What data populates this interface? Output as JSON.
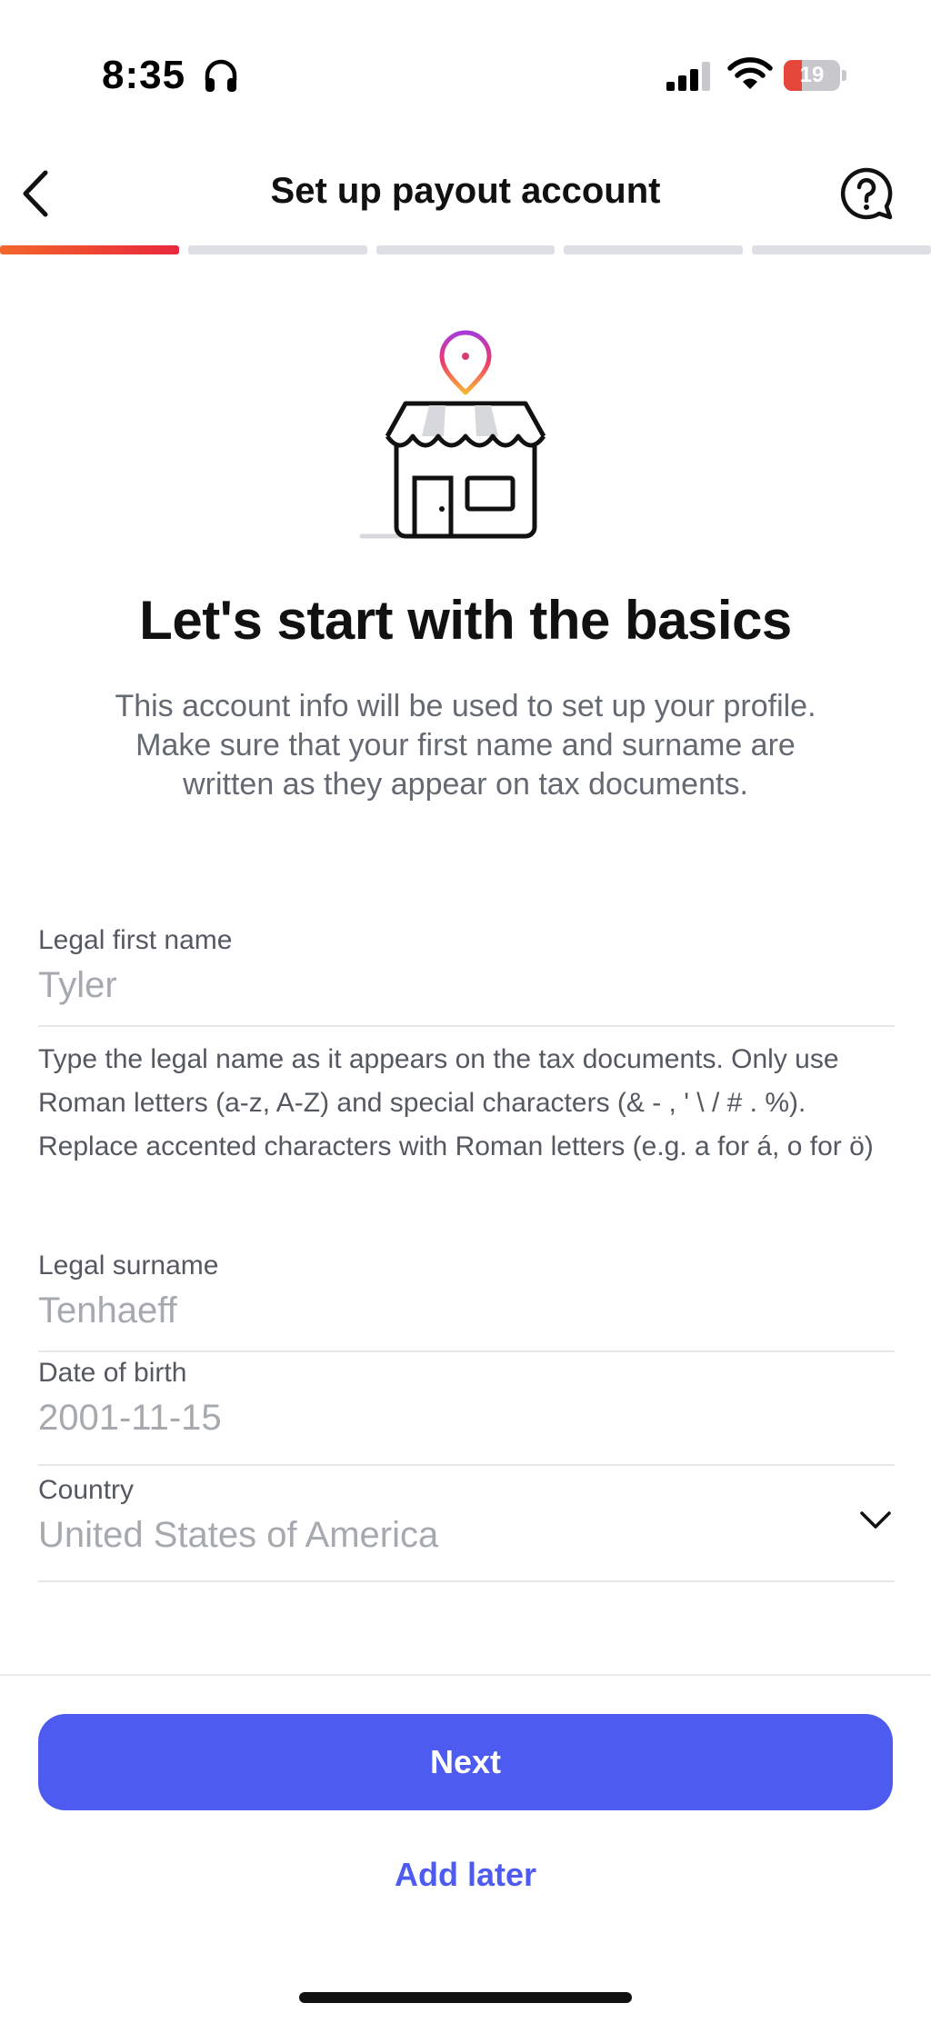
{
  "status_bar": {
    "time": "8:35",
    "battery_level": "19",
    "battery_fraction": 0.19,
    "icons": [
      "headphones-icon",
      "signal-icon",
      "wifi-icon",
      "battery-icon"
    ]
  },
  "header": {
    "title": "Set up payout account",
    "back_icon": "chevron-left-icon",
    "help_icon": "question-chat-icon"
  },
  "progress": {
    "total_steps": 5,
    "current_step": 1
  },
  "illustration": {
    "icon": "storefront-location-icon"
  },
  "intro": {
    "heading": "Let's start with the basics",
    "description": "This account info will be used to set up your profile. Make sure that your first name and surname are written as they appear on tax documents."
  },
  "form": {
    "first_name": {
      "label": "Legal first name",
      "value": "Tyler"
    },
    "helper": "Type the legal name as it appears on the tax documents. Only use Roman letters (a-z, A-Z) and special characters (& - , ' \\ / # . %). Replace accented characters with Roman letters (e.g. a for á, o for ö)",
    "surname": {
      "label": "Legal surname",
      "value": "Tenhaeff"
    },
    "dob": {
      "label": "Date of birth",
      "value": "2001-11-15"
    },
    "country": {
      "label": "Country",
      "value": "United States of America",
      "icon": "chevron-down-icon"
    }
  },
  "actions": {
    "next_label": "Next",
    "add_later_label": "Add later"
  },
  "colors": {
    "primary": "#4e5bf0",
    "progress_active_start": "#f2662a",
    "progress_active_end": "#e8283c",
    "progress_inactive": "#dcdfe3",
    "battery_low": "#e5483b"
  }
}
